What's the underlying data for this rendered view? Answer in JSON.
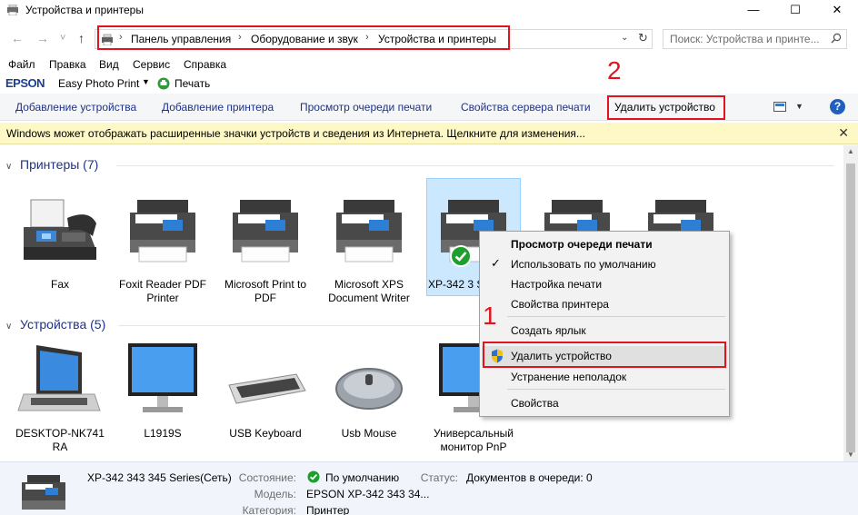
{
  "window": {
    "title": "Устройства и принтеры",
    "minimize": "—",
    "maximize": "☐",
    "close": "✕"
  },
  "address": {
    "back": "←",
    "forward": "→",
    "recent": "˅",
    "up": "↑",
    "breadcrumbs": [
      "Панель управления",
      "Оборудование и звук",
      "Устройства и принтеры"
    ],
    "search_placeholder": "Поиск: Устройства и принте..."
  },
  "menubar": [
    "Файл",
    "Правка",
    "Вид",
    "Сервис",
    "Справка"
  ],
  "pluginbar": {
    "brand": "EPSON",
    "easy_photo_print": "Easy Photo Print",
    "print": "Печать"
  },
  "commands": {
    "add_device": "Добавление устройства",
    "add_printer": "Добавление принтера",
    "print_queue": "Просмотр очереди печати",
    "server_props": "Свойства сервера печати",
    "remove_device": "Удалить устройство",
    "help": "?"
  },
  "infobar": {
    "text": "Windows может отображать расширенные значки устройств и сведения из Интернета.  Щелкните для изменения...",
    "close": "✕"
  },
  "groups": {
    "printers": {
      "title": "Принтеры (7)",
      "items": [
        {
          "label": "Fax",
          "kind": "fax"
        },
        {
          "label": "Foxit Reader PDF Printer",
          "kind": "printer"
        },
        {
          "label": "Microsoft Print to PDF",
          "kind": "printer"
        },
        {
          "label": "Microsoft XPS Document Writer",
          "kind": "printer"
        },
        {
          "label": "XP-342 3 Series(С",
          "kind": "printer",
          "selected": true,
          "default": true
        },
        {
          "label": "",
          "kind": "printer"
        },
        {
          "label": "",
          "kind": "printer"
        }
      ]
    },
    "devices": {
      "title": "Устройства (5)",
      "items": [
        {
          "label": "DESKTOP-NK741 RA",
          "kind": "laptop"
        },
        {
          "label": "L1919S",
          "kind": "monitor"
        },
        {
          "label": "USB Keyboard",
          "kind": "keyboard"
        },
        {
          "label": "Usb Mouse",
          "kind": "mouse"
        },
        {
          "label": "Универсальный монитор PnP",
          "kind": "monitor"
        }
      ]
    }
  },
  "context_menu": {
    "items": [
      {
        "label": "Просмотр очереди печати",
        "bold": true
      },
      {
        "label": "Использовать по умолчанию",
        "checked": true
      },
      {
        "label": "Настройка печати"
      },
      {
        "label": "Свойства принтера"
      },
      {
        "label": "Создать ярлык"
      },
      {
        "label": "Удалить устройство",
        "shield": true,
        "hover": true
      },
      {
        "label": "Устранение неполадок"
      },
      {
        "label": "Свойства"
      }
    ]
  },
  "annotations": {
    "one": "1",
    "two": "2"
  },
  "details": {
    "name": "XP-342 343 345 Series(Сеть)",
    "state_label": "Состояние:",
    "state_value": "По умолчанию",
    "status_label": "Статус:",
    "status_value": "Документов в очереди: 0",
    "model_label": "Модель:",
    "model_value": "EPSON XP-342 343 34...",
    "category_label": "Категория:",
    "category_value": "Принтер"
  },
  "colors": {
    "accent_blue": "#1e3287",
    "annotation_red": "#e0141e",
    "selection": "#cce8ff",
    "infobar": "#fdf8c5",
    "default_green": "#1d9f2d"
  }
}
